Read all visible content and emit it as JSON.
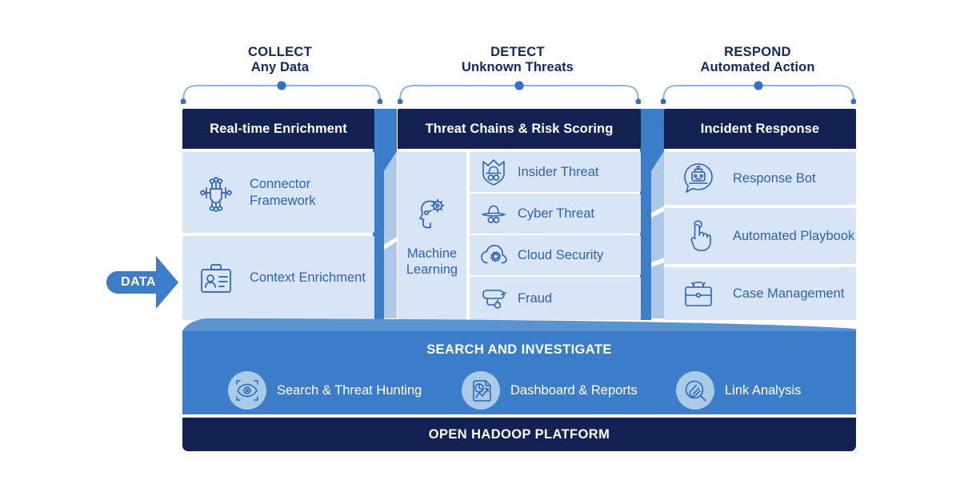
{
  "flow_arrow": {
    "label": "DATA",
    "color": "#3b7dc8"
  },
  "phases": [
    {
      "title": "COLLECT",
      "subtitle": "Any Data"
    },
    {
      "title": "DETECT",
      "subtitle": "Unknown Threats"
    },
    {
      "title": "RESPOND",
      "subtitle": "Automated Action"
    }
  ],
  "columns": [
    {
      "header": "Real-time Enrichment",
      "items": [
        {
          "label": "Connector Framework",
          "icon": "connector-framework-icon"
        },
        {
          "label": "Context Enrichment",
          "icon": "context-enrichment-icon"
        }
      ]
    },
    {
      "header": "Threat Chains & Risk Scoring",
      "machine_learning": {
        "label": "Machine Learning",
        "icon": "machine-learning-icon"
      },
      "items": [
        {
          "label": "Insider Threat",
          "icon": "insider-threat-icon"
        },
        {
          "label": "Cyber Threat",
          "icon": "cyber-threat-icon"
        },
        {
          "label": "Cloud Security",
          "icon": "cloud-security-icon"
        },
        {
          "label": "Fraud",
          "icon": "fraud-icon"
        }
      ]
    },
    {
      "header": "Incident Response",
      "items": [
        {
          "label": "Response Bot",
          "icon": "response-bot-icon"
        },
        {
          "label": "Automated Playbook",
          "icon": "automated-playbook-icon"
        },
        {
          "label": "Case Management",
          "icon": "case-management-icon"
        }
      ]
    }
  ],
  "search_band": {
    "title": "SEARCH AND INVESTIGATE",
    "items": [
      {
        "label": "Search & Threat Hunting",
        "icon": "search-eye-icon"
      },
      {
        "label": "Dashboard & Reports",
        "icon": "dashboard-reports-icon"
      },
      {
        "label": "Link Analysis",
        "icon": "link-analysis-icon"
      }
    ]
  },
  "footer": {
    "label": "OPEN HADOOP PLATFORM"
  },
  "colors": {
    "navy": "#132252",
    "mid_blue": "#3b7dc8",
    "light_panel": "#d8e5f6",
    "panel_side": "#aec8e8",
    "text_blue": "#2e62b5",
    "bracket": "#8fb4e0"
  }
}
